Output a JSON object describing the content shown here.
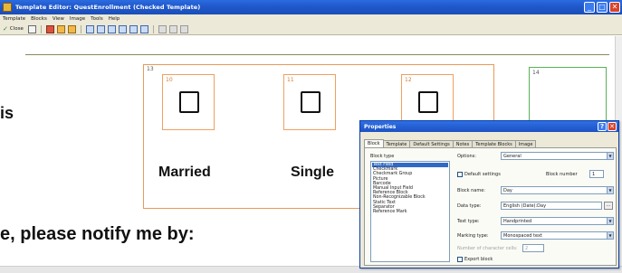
{
  "window": {
    "title": "Template Editor: QuestEnrollment (Checked Template)",
    "buttons": {
      "minimize": "_",
      "maximize": "□",
      "close": "✕"
    }
  },
  "menu": {
    "items": [
      "Template",
      "Blocks",
      "View",
      "Image",
      "Tools",
      "Help"
    ]
  },
  "toolbar": {
    "close_label": "Close"
  },
  "document": {
    "text_left_top": "is",
    "text_left_bottom": "e, please notify me by:",
    "block13_number": "13",
    "block14_number": "14",
    "checkboxes": [
      {
        "number": "10",
        "label": "Married"
      },
      {
        "number": "11",
        "label": "Single"
      },
      {
        "number": "12",
        "label": ""
      }
    ]
  },
  "dialog": {
    "title": "Properties",
    "help_button": "?",
    "close_button": "✕",
    "tabs": [
      "Block",
      "Template",
      "Default Settings",
      "Notes",
      "Template Blocks",
      "Image"
    ],
    "active_tab": "Block",
    "block_type_label": "Block type",
    "block_types": [
      "Text Field",
      "Checkmark",
      "Checkmark Group",
      "Picture",
      "Barcode",
      "Manual Input Field",
      "Reference Block",
      "Non-Recognizable Block",
      "Static Text",
      "Separator",
      "Reference Mark"
    ],
    "selected_block_type": "Text Field",
    "options_label": "Options:",
    "options_value": "General",
    "default_settings_label": "Default settings",
    "block_number_label": "Block number",
    "block_number_value": "1",
    "block_name_label": "Block name:",
    "block_name_value": "Day",
    "data_type_label": "Data type:",
    "data_type_value": "English (Date):Day",
    "text_type_label": "Text type:",
    "text_type_value": "Handprinted",
    "marking_type_label": "Marking type:",
    "marking_type_value": "Monospaced text",
    "char_cells_label": "Number of character cells:",
    "char_cells_value": "2",
    "export_block_label": "Export block"
  }
}
